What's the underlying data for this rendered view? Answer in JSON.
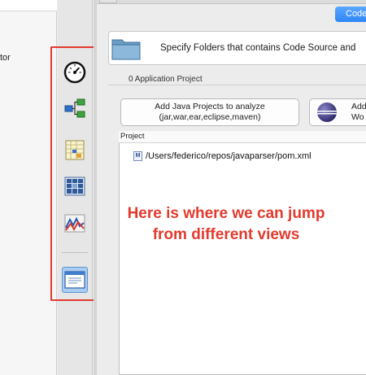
{
  "left_pane": {
    "label": "tor"
  },
  "view_switcher": {
    "items": [
      {
        "icon": "dashboard-gauge-icon"
      },
      {
        "icon": "hierarchy-icon"
      },
      {
        "icon": "sheet-icon"
      },
      {
        "icon": "grid-icon"
      },
      {
        "icon": "trend-chart-icon"
      },
      {
        "icon": "window-icon",
        "selected": true
      }
    ]
  },
  "toolbar": {
    "code_button_label": "Code"
  },
  "banner": {
    "text": "Specify Folders that contains Code Source and"
  },
  "section": {
    "label": "0 Application Project"
  },
  "actions": {
    "java_line1": "Add Java Projects to analyze",
    "java_line2": "(jar,war,ear,eclipse,maven)",
    "eclipse_line1": "Add",
    "eclipse_line2": "Wo"
  },
  "projects": {
    "header": "Project",
    "rows": [
      {
        "icon": "maven-icon",
        "glyph": "M",
        "path": "/Users/federico/repos/javaparser/pom.xml"
      }
    ]
  },
  "annotation": {
    "line1": "Here is where we can jump",
    "line2": "from different views",
    "color": "#e23b2e"
  },
  "colors": {
    "accent": "#2f86f5",
    "annotation": "#e23b2e"
  }
}
